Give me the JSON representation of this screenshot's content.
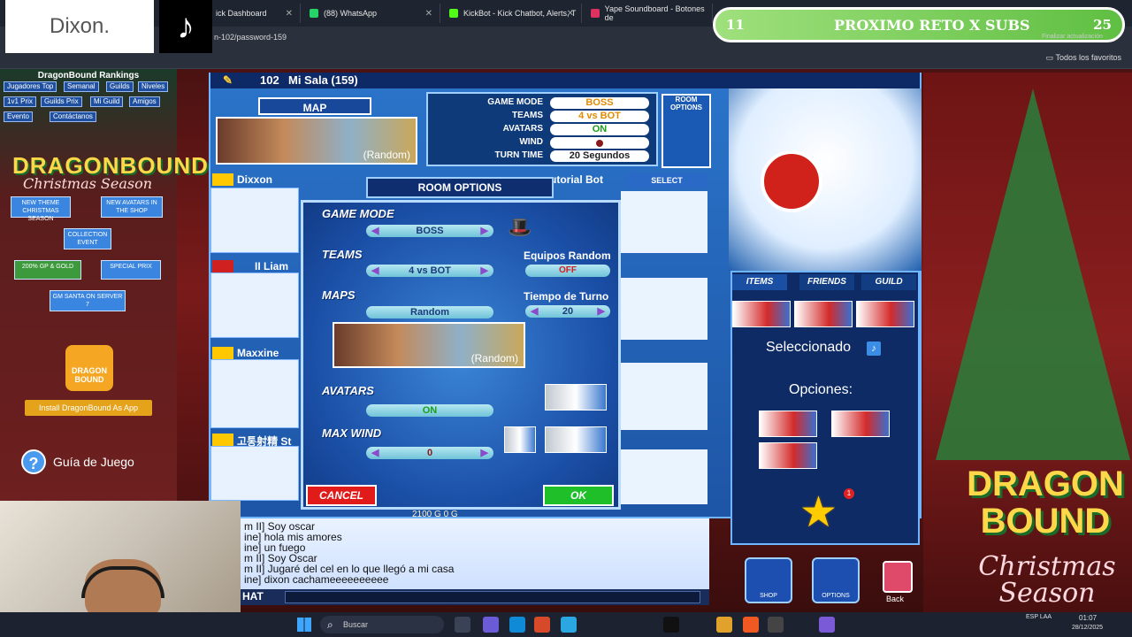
{
  "browser": {
    "tabs": [
      {
        "label": "ick Dashboard"
      },
      {
        "label": "(88) WhatsApp"
      },
      {
        "label": "KickBot - Kick Chatbot, Alerts, T"
      },
      {
        "label": "Yape Soundboard - Botones de"
      }
    ],
    "address": "n-102/password-159",
    "favorites_label": "Todos los favoritos",
    "update_label": "Finalizar actualización"
  },
  "overlay": {
    "streamer_name": "Dixon.",
    "subs_current": "11",
    "subs_label": "PROXIMO RETO X SUBS",
    "subs_goal": "25"
  },
  "left_panel": {
    "title": "DragonBound Rankings",
    "nav": [
      "Jugadores Top",
      "Semanal",
      "Guilds",
      "Niveles",
      "1v1 Prix",
      "Guilds Prix",
      "Mi Guild",
      "Amigos",
      "Evento",
      "Contáctanos"
    ],
    "logo_main": "DRAGONBOUND",
    "logo_sub": "Christmas Season",
    "promos": [
      "NEW THEME CHRISTMAS SEASON",
      "NEW AVATARS IN THE SHOP",
      "COLLECTION EVENT",
      "200% GP & GOLD",
      "SPECIAL PRIX",
      "GM SANTA ON SERVER 7"
    ],
    "app_icon_label": "DRAGON BOUND",
    "install_button": "Install DragonBound As App",
    "guide_label": "Guía de Juego"
  },
  "room": {
    "number": "102",
    "name": "Mi Sala (159)",
    "map_label": "MAP",
    "map_thumb_label": "(Random)",
    "settings": [
      {
        "label": "GAME MODE",
        "value": "BOSS"
      },
      {
        "label": "TEAMS",
        "value": "4 vs BOT"
      },
      {
        "label": "AVATARS",
        "value": "ON"
      },
      {
        "label": "WIND",
        "value": ""
      },
      {
        "label": "TURN TIME",
        "value": "20 Segundos"
      }
    ],
    "room_options_icon": "ROOM OPTIONS",
    "players": [
      "Dixxon",
      "II Liam",
      "Maxxine",
      "고통射精 St"
    ],
    "tutorial_title": "utorial Bot",
    "select_tab": "SELECT",
    "gold": "2100 G     0 G"
  },
  "modal": {
    "title": "ROOM OPTIONS",
    "game_mode_label": "GAME MODE",
    "game_mode_value": "BOSS",
    "teams_label": "TEAMS",
    "teams_value": "4 vs BOT",
    "random_teams_label": "Equipos Random",
    "random_teams_value": "OFF",
    "maps_label": "MAPS",
    "maps_value": "Random",
    "turn_time_label": "Tiempo de Turno",
    "turn_time_value": "20",
    "map_preview_label": "(Random)",
    "avatars_label": "AVATARS",
    "avatars_value": "ON",
    "max_wind_label": "MAX WIND",
    "max_wind_value": "0",
    "cancel_label": "CANCEL",
    "ok_label": "OK"
  },
  "items_panel": {
    "tabs": [
      "ITEMS",
      "FRIENDS",
      "GUILD"
    ],
    "selected_label": "Seleccionado",
    "options_label": "Opciones:",
    "notification_count": "1",
    "bottom_buttons": [
      "SHOP",
      "OPTIONS",
      "Back"
    ]
  },
  "promo_right": {
    "logo": "DRAGON BOUND",
    "season": "Christmas Season"
  },
  "chat": {
    "label": "HAT",
    "lines": [
      "m II] Soy oscar",
      "ine] hola mis amores",
      "ine] un fuego",
      "m II] Soy Oscar",
      "m II] Jugaré del cel en lo que llegó a mi casa",
      "ine] dixon cachameeeeeeeeee"
    ]
  },
  "taskbar": {
    "search_placeholder": "Buscar",
    "language": "ESP LAA",
    "time": "01:07",
    "date": "28/12/2025"
  },
  "colors": {
    "accent_blue": "#2a74c9",
    "subs_green": "#5fbf42",
    "cancel_red": "#e11a1a",
    "ok_green": "#1fbf2a"
  }
}
